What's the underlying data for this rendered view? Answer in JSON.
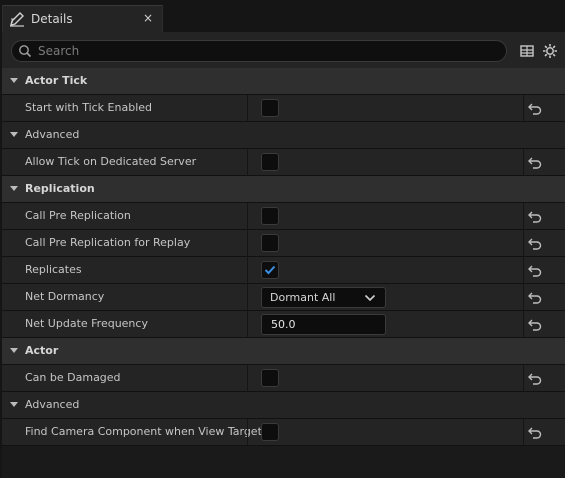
{
  "tab": {
    "title": "Details",
    "icon": "pencil-icon",
    "close_glyph": "×"
  },
  "search": {
    "placeholder": "Search",
    "value": ""
  },
  "toolbar": {
    "grid_icon": "table-icon",
    "settings_icon": "gear-icon"
  },
  "sections": {
    "actor_tick": {
      "title": "Actor Tick",
      "start_with_tick_enabled": {
        "label": "Start with Tick Enabled",
        "checked": false
      },
      "advanced": {
        "title": "Advanced",
        "allow_tick_dedicated_server": {
          "label": "Allow Tick on Dedicated Server",
          "checked": false
        }
      }
    },
    "replication": {
      "title": "Replication",
      "call_pre_replication": {
        "label": "Call Pre Replication",
        "checked": false
      },
      "call_pre_replication_replay": {
        "label": "Call Pre Replication for Replay",
        "checked": false
      },
      "replicates": {
        "label": "Replicates",
        "checked": true
      },
      "net_dormancy": {
        "label": "Net Dormancy",
        "value": "Dormant All"
      },
      "net_update_frequency": {
        "label": "Net Update Frequency",
        "value": "50.0"
      }
    },
    "actor": {
      "title": "Actor",
      "can_be_damaged": {
        "label": "Can be Damaged",
        "checked": false
      },
      "advanced": {
        "title": "Advanced",
        "find_camera_component": {
          "label": "Find Camera Component when View Target",
          "checked": false
        }
      }
    }
  },
  "colors": {
    "accent_check": "#3a8fe0",
    "background": "#1a1a1a",
    "category_bg": "#2f2f2f"
  }
}
